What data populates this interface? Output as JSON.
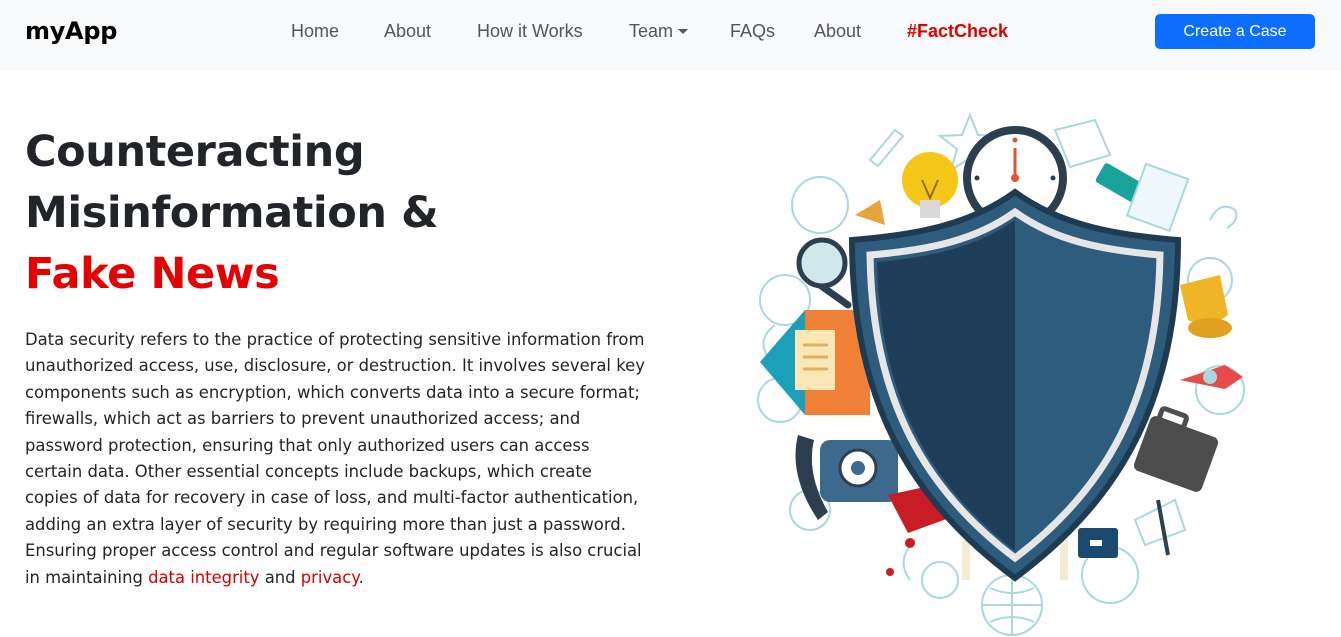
{
  "brand": "myApp",
  "nav": {
    "home": "Home",
    "about": "About",
    "how": "How it Works",
    "team": "Team",
    "faqs": "FAQs",
    "about2": "About",
    "factcheck": "#FactCheck",
    "cta": "Create a Case"
  },
  "hero": {
    "line1": "Counteracting",
    "line2": "Misinformation &",
    "line3": "Fake News"
  },
  "description": {
    "text": "Data security refers to the practice of protecting sensitive information from unauthorized access, use, disclosure, or destruction. It involves several key components such as encryption, which converts data into a secure format; firewalls, which act as barriers to prevent unauthorized access; and password protection, ensuring that only authorized users can access certain data. Other essential concepts include backups, which create copies of data for recovery in case of loss, and multi-factor authentication, adding an extra layer of security by requiring more than just a password. Ensuring proper access control and regular software updates is also crucial in maintaining ",
    "link1": "data integrity",
    "and": " and ",
    "link2": "privacy",
    "end": "."
  },
  "colors": {
    "accent_red": "#e60000",
    "primary_blue": "#0d6efd",
    "navbar_bg": "#f8f9fa",
    "shield_dark": "#1e3d58",
    "shield_light": "#2e5c7c"
  }
}
